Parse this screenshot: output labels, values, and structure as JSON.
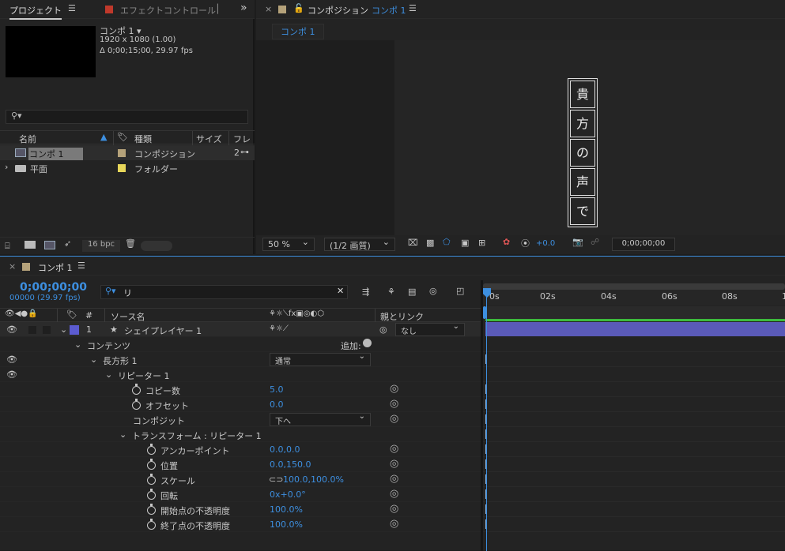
{
  "project": {
    "tab": "プロジェクト",
    "tab2": "エフェクトコントロール",
    "comp_name": "コンポ 1",
    "comp_res": "1920 x 1080 (1.00)",
    "comp_dur": "Δ 0;00;15;00, 29.97 fps",
    "col_name": "名前",
    "col_type": "種類",
    "col_size": "サイズ",
    "col_frame": "フレ",
    "items": [
      {
        "name": "コンポ 1",
        "type": "コンポジション",
        "size": "2"
      },
      {
        "name": "平面",
        "type": "フォルダー",
        "size": ""
      }
    ],
    "bpc": "16 bpc"
  },
  "viewer": {
    "title": "コンポジション",
    "comp_link": "コンポ 1",
    "tab": "コンポ 1",
    "zoom": "50 %",
    "quality": "(1/2 画質)",
    "exposure": "+0.0",
    "timecode": "0;00;00;00",
    "text_chars": [
      "貴",
      "方",
      "の",
      "声",
      "で"
    ]
  },
  "timeline": {
    "tab": "コンポ 1",
    "timecode": "0;00;00;00",
    "frames": "00000 (29.97 fps)",
    "search": "リ",
    "col_source": "ソース名",
    "col_parent": "親とリンク",
    "col_num": "#",
    "layer_num": "1",
    "layer_name": "シェイプレイヤー 1",
    "parent_value": "なし",
    "contents": "コンテンツ",
    "add": "追加:",
    "rect": "長方形 1",
    "blend": "通常",
    "repeater": "リピーター 1",
    "copies_label": "コピー数",
    "copies": "5.0",
    "offset_label": "オフセット",
    "offset": "0.0",
    "composite_label": "コンポジット",
    "composite": "下へ",
    "transform": "トランスフォーム : リピーター 1",
    "anchor_label": "アンカーポイント",
    "anchor": "0.0,0.0",
    "position_label": "位置",
    "position": "0.0,150.0",
    "scale_label": "スケール",
    "scale": "100.0,100.0%",
    "rotation_label": "回転",
    "rotation": "0x+0.0°",
    "start_op_label": "開始点の不透明度",
    "start_op": "100.0%",
    "end_op_label": "終了点の不透明度",
    "end_op": "100.0%",
    "ruler": [
      "0s",
      "02s",
      "04s",
      "06s",
      "08s",
      "1"
    ]
  },
  "colors": {
    "accent": "#3d8fe0",
    "layer": "#5b5bd0",
    "label": "#b5a27a",
    "folder": "#e8d75a"
  }
}
